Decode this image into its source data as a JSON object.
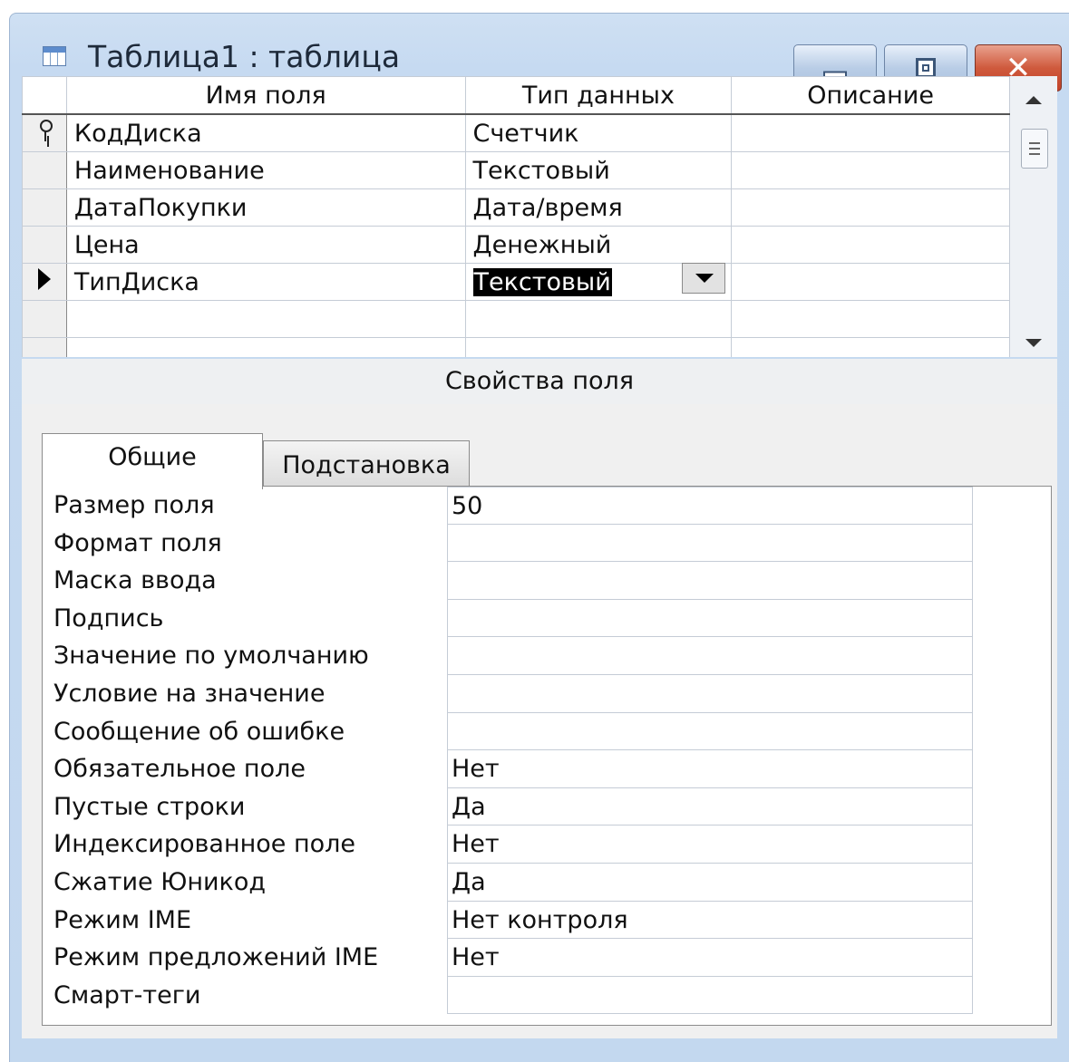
{
  "window": {
    "title": "Таблица1 : таблица"
  },
  "grid": {
    "columns": [
      "Имя поля",
      "Тип данных",
      "Описание"
    ],
    "rows": [
      {
        "name": "КодДиска",
        "type": "Счетчик",
        "description": "",
        "marker": "key-icon"
      },
      {
        "name": "Наименование",
        "type": "Текстовый",
        "description": "",
        "marker": ""
      },
      {
        "name": "ДатаПокупки",
        "type": "Дата/время",
        "description": "",
        "marker": ""
      },
      {
        "name": "Цена",
        "type": "Денежный",
        "description": "",
        "marker": ""
      },
      {
        "name": "ТипДиска",
        "type": "Текстовый",
        "description": "",
        "marker": "current-row-pointer-icon"
      },
      {
        "name": "",
        "type": "",
        "description": "",
        "marker": ""
      }
    ]
  },
  "props": {
    "caption": "Свойства поля",
    "tabs": {
      "general": "Общие",
      "lookup": "Подстановка"
    },
    "rows": [
      {
        "label": "Размер поля",
        "value": "50"
      },
      {
        "label": "Формат поля",
        "value": ""
      },
      {
        "label": "Маска ввода",
        "value": ""
      },
      {
        "label": "Подпись",
        "value": ""
      },
      {
        "label": "Значение по умолчанию",
        "value": ""
      },
      {
        "label": "Условие на значение",
        "value": ""
      },
      {
        "label": "Сообщение об ошибке",
        "value": ""
      },
      {
        "label": "Обязательное поле",
        "value": "Нет"
      },
      {
        "label": "Пустые строки",
        "value": "Да"
      },
      {
        "label": "Индексированное поле",
        "value": "Нет"
      },
      {
        "label": "Сжатие Юникод",
        "value": "Да"
      },
      {
        "label": "Режим IME",
        "value": "Нет контроля"
      },
      {
        "label": "Режим предложений IME",
        "value": "Нет"
      },
      {
        "label": "Смарт-теги",
        "value": ""
      }
    ]
  },
  "colors": {
    "frame": "#c3d8ef",
    "close_button": "#c2432a",
    "selection": "#000000"
  }
}
